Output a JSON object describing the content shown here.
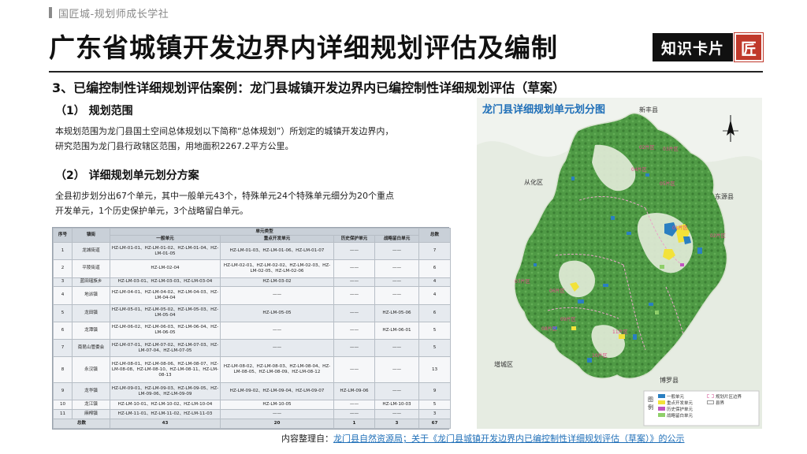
{
  "header": {
    "brand": "国匠城-规划师成长学社",
    "title": "广东省城镇开发边界内详细规划评估及编制",
    "badge": "知识卡片",
    "badge_logo": "匠"
  },
  "section_title": "3、已编控制性详细规划评估案例：龙门县城镇开发边界内已编控制性详细规划评估（草案）",
  "part1": {
    "heading": "（1） 规划范围",
    "line1": "本规划范围为龙门县国土空间总体规划以下简称“总体规划”）所划定的城镇开发边界内，",
    "line2": "研究范围为龙门县行政辖区范围，用地面积2267.2平方公里。"
  },
  "part2": {
    "heading": "（2） 详细规划单元划分方案",
    "line1": "全县初步划分出67个单元，其中一般单元43个，特殊单元24个特殊单元细分为20个重点",
    "line2": "开发单元，1个历史保护单元，3个战略留白单元。"
  },
  "table": {
    "h_seq": "序号",
    "h_town": "镇街",
    "h_type": "单元类型",
    "h_general": "一般单元",
    "h_key": "重点开发单元",
    "h_hist": "历史保护单元",
    "h_strat": "战略留白单元",
    "h_total": "总数",
    "rows": [
      [
        "1",
        "龙城街道",
        "HZ-LM-01-01、HZ-LM-01-02、HZ-LM-01-04、HZ-LM-01-05",
        "HZ-LM-01-03、HZ-LM-01-06、HZ-LM-01-07",
        "——",
        "——",
        "7"
      ],
      [
        "2",
        "平陵街道",
        "HZ-LM-02-04",
        "HZ-LM-02-01、HZ-LM-02-02、HZ-LM-02-03、HZ-LM-02-05、HZ-LM-02-06",
        "——",
        "——",
        "6"
      ],
      [
        "3",
        "蓝田瑶族乡",
        "HZ-LM-03-01、HZ-LM-03-03、HZ-LM-03-04",
        "HZ-LM-03-02",
        "——",
        "——",
        "4"
      ],
      [
        "4",
        "地派镇",
        "HZ-LM-04-01、HZ-LM-04-02、HZ-LM-04-03、HZ-LM-04-04",
        "——",
        "——",
        "——",
        "4"
      ],
      [
        "5",
        "龙田镇",
        "HZ-LM-05-01、HZ-LM-05-02、HZ-LM-05-03、HZ-LM-05-04",
        "HZ-LM-05-05",
        "——",
        "HZ-LM-05-06",
        "6"
      ],
      [
        "6",
        "龙潭镇",
        "HZ-LM-06-02、HZ-LM-06-03、HZ-LM-06-04、HZ-LM-06-05",
        "——",
        "——",
        "HZ-LM-06-01",
        "5"
      ],
      [
        "7",
        "南昆山管委会",
        "HZ-LM-07-01、HZ-LM-07-02、HZ-LM-07-03、HZ-LM-07-04、HZ-LM-07-05",
        "——",
        "——",
        "——",
        "5"
      ],
      [
        "8",
        "永汉镇",
        "HZ-LM-08-01、HZ-LM-08-06、HZ-LM-08-07、HZ-LM-08-08、HZ-LM-08-10、HZ-LM-08-11、HZ-LM-08-13",
        "HZ-LM-08-02、HZ-LM-08-03、HZ-LM-08-04、HZ-LM-08-05、HZ-LM-08-09、HZ-LM-08-12",
        "——",
        "——",
        "13"
      ],
      [
        "9",
        "龙华镇",
        "HZ-LM-09-01、HZ-LM-09-03、HZ-LM-09-05、HZ-LM-09-06、HZ-LM-09-09",
        "HZ-LM-09-02、HZ-LM-09-04、HZ-LM-09-07",
        "HZ-LM-09-06",
        "——",
        "9"
      ],
      [
        "10",
        "龙江镇",
        "HZ-LM-10-01、HZ-LM-10-02、HZ-LM-10-04",
        "HZ-LM-10-05",
        "——",
        "HZ-LM-10-03",
        "5"
      ],
      [
        "11",
        "麻榨镇",
        "HZ-LM-11-01、HZ-LM-11-02、HZ-LM-11-03",
        "——",
        "——",
        "——",
        "3"
      ]
    ],
    "total": [
      "总数",
      "43",
      "20",
      "1",
      "3",
      "67"
    ]
  },
  "map": {
    "title": "龙门县详细规划单元划分图",
    "labels": {
      "xinfeng": "新丰县",
      "conghua": "从化区",
      "dongyuan": "东源县",
      "zengcheng": "增城区",
      "boluo": "博罗县"
    },
    "districts": [
      "02片区",
      "03片区",
      "04片区",
      "05片区",
      "01片区",
      "02片区",
      "07片区",
      "06片区",
      "08片区",
      "11片区",
      "10片区",
      "09片区"
    ],
    "legend": {
      "heading": "图例",
      "general": "一般单元",
      "key": "重点开发单元",
      "hist": "历史保护单元",
      "strat": "战略留白单元",
      "boundary": "规划片区边界",
      "county": "县界"
    },
    "colors": {
      "general": "#2a7fc1",
      "key": "#f2e23a",
      "hist": "#c054c0",
      "strat": "#8fcf6a",
      "forest": "#3e8a3a",
      "plain": "#e8efe4"
    }
  },
  "caption": {
    "prefix": "内容整理自：",
    "source": "龙门县自然资源局；关于《龙门县城镇开发边界内已编控制性详细规划评估（草案）》的公示"
  }
}
